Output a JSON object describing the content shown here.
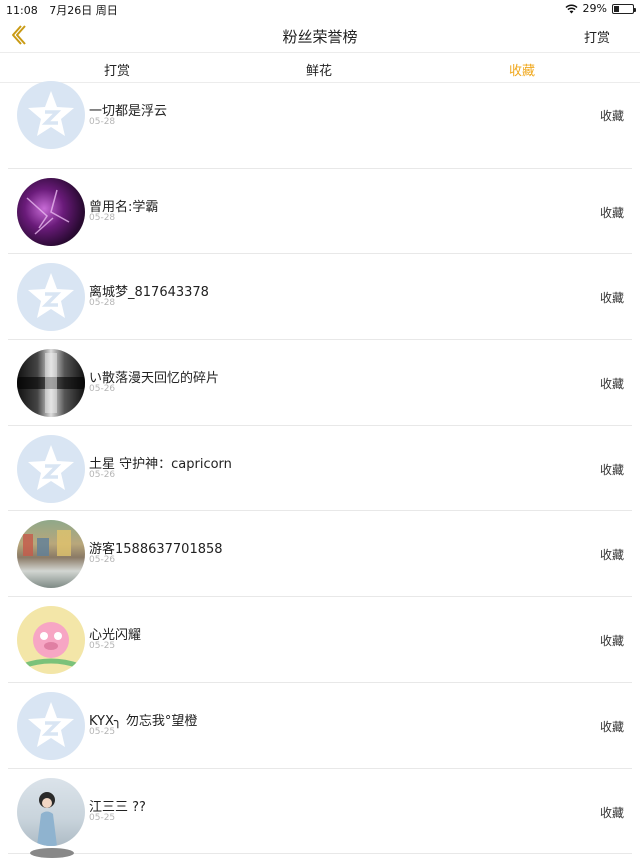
{
  "status_bar": {
    "time": "11:08",
    "date": "7月26日 周日",
    "battery_text": "29%",
    "battery_level": 0.29
  },
  "nav": {
    "title": "粉丝荣誉榜",
    "action_label": "打赏"
  },
  "tabs": [
    {
      "label": "打赏"
    },
    {
      "label": "鲜花"
    },
    {
      "label": "收藏"
    }
  ],
  "colors": {
    "accent": "#f0a81e",
    "back": "#c99a14",
    "default_avatar_bg": "#d9e5f3"
  },
  "items": [
    {
      "name": "一切都是浮云",
      "date": "05-28",
      "type": "收藏",
      "avatar": "default-qq-avatar"
    },
    {
      "name": "曾用名:学霸",
      "date": "05-28",
      "type": "收藏",
      "avatar": "purple-abstract-avatar"
    },
    {
      "name": "离城梦_817643378",
      "date": "05-28",
      "type": "收藏",
      "avatar": "default-qq-avatar"
    },
    {
      "name": "い散落漫天回忆的碎片",
      "date": "05-26",
      "type": "收藏",
      "avatar": "dark-photo-avatar"
    },
    {
      "name": "土星 守护神：capricorn",
      "date": "05-26",
      "type": "收藏",
      "avatar": "default-qq-avatar"
    },
    {
      "name": "游客1588637701858",
      "date": "05-26",
      "type": "收藏",
      "avatar": "seaside-town-avatar"
    },
    {
      "name": "心光闪耀",
      "date": "05-25",
      "type": "收藏",
      "avatar": "cartoon-pig-avatar"
    },
    {
      "name": "KYX╮ 勿忘我°望橙",
      "date": "05-25",
      "type": "收藏",
      "avatar": "default-qq-avatar"
    },
    {
      "name": "江三三 ??",
      "date": "05-25",
      "type": "收藏",
      "avatar": "girl-photo-avatar"
    }
  ]
}
